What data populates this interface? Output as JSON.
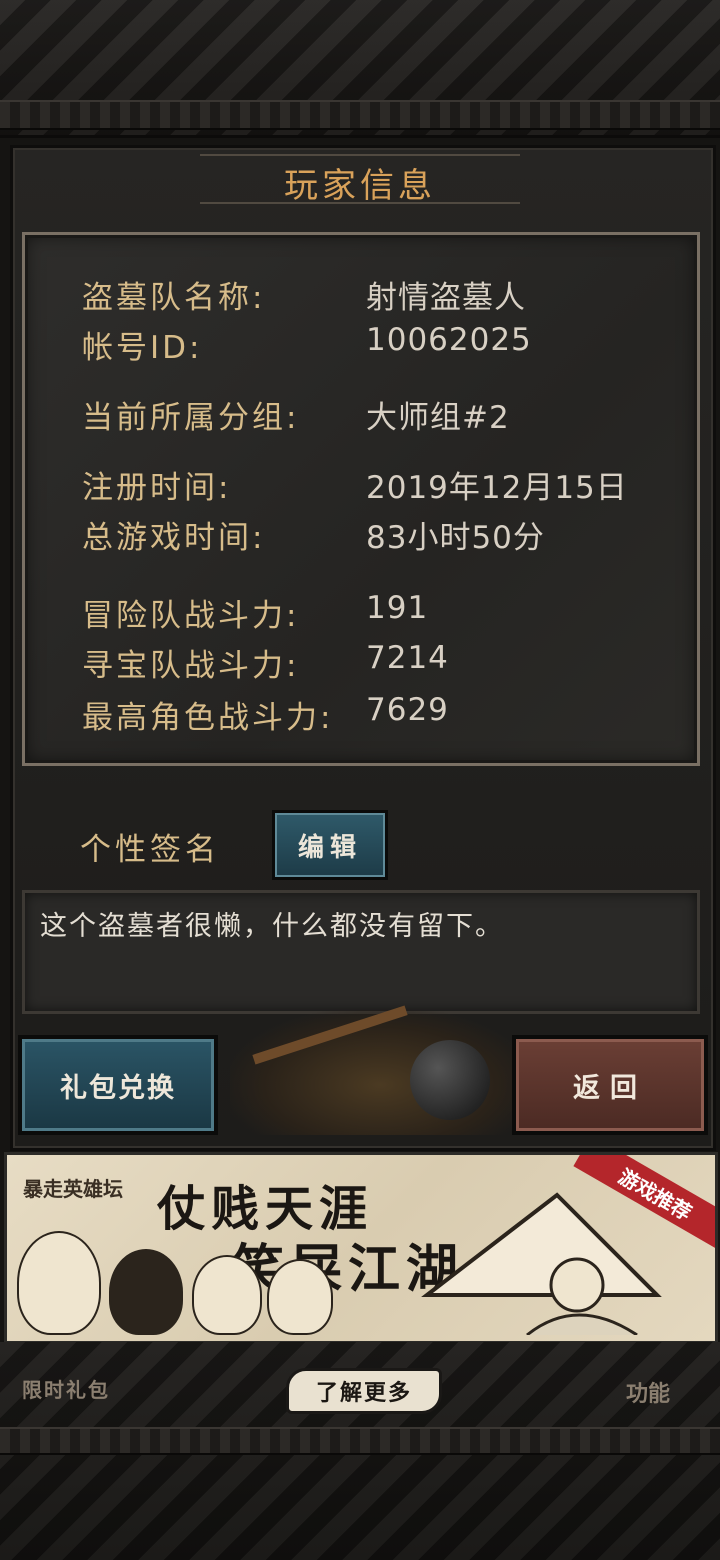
{
  "title": "玩家信息",
  "info": [
    {
      "label": "盗墓队名称:",
      "value": "射情盗墓人"
    },
    {
      "label": "帐号ID:",
      "value": "10062025"
    },
    {
      "label": "当前所属分组:",
      "value": "大师组#2"
    },
    {
      "label": "注册时间:",
      "value": "2019年12月15日"
    },
    {
      "label": "总游戏时间:",
      "value": "83小时50分"
    },
    {
      "label": "冒险队战斗力:",
      "value": "191"
    },
    {
      "label": "寻宝队战斗力:",
      "value": "7214"
    },
    {
      "label": "最高角色战斗力:",
      "value": "7629"
    }
  ],
  "signature": {
    "label": "个性签名",
    "edit_button": "编辑",
    "text": "这个盗墓者很懒，什么都没有留下。"
  },
  "buttons": {
    "gift_redeem": "礼包兑换",
    "back": "返回"
  },
  "ad": {
    "logo": "暴走英雄坛",
    "line1": "仗贱天涯",
    "line2": "笑屎江湖",
    "tag": "游戏推荐"
  },
  "bottom": {
    "limited_gift": "限时礼包",
    "learn_more": "了解更多",
    "function": "功能"
  },
  "colors": {
    "label": "#d7bc8a",
    "value": "#d8d0c4",
    "title": "#d9a25a",
    "edit_button": "#2f5a6a",
    "back_button": "#6b3f35",
    "ad_tag": "#b4262b"
  }
}
